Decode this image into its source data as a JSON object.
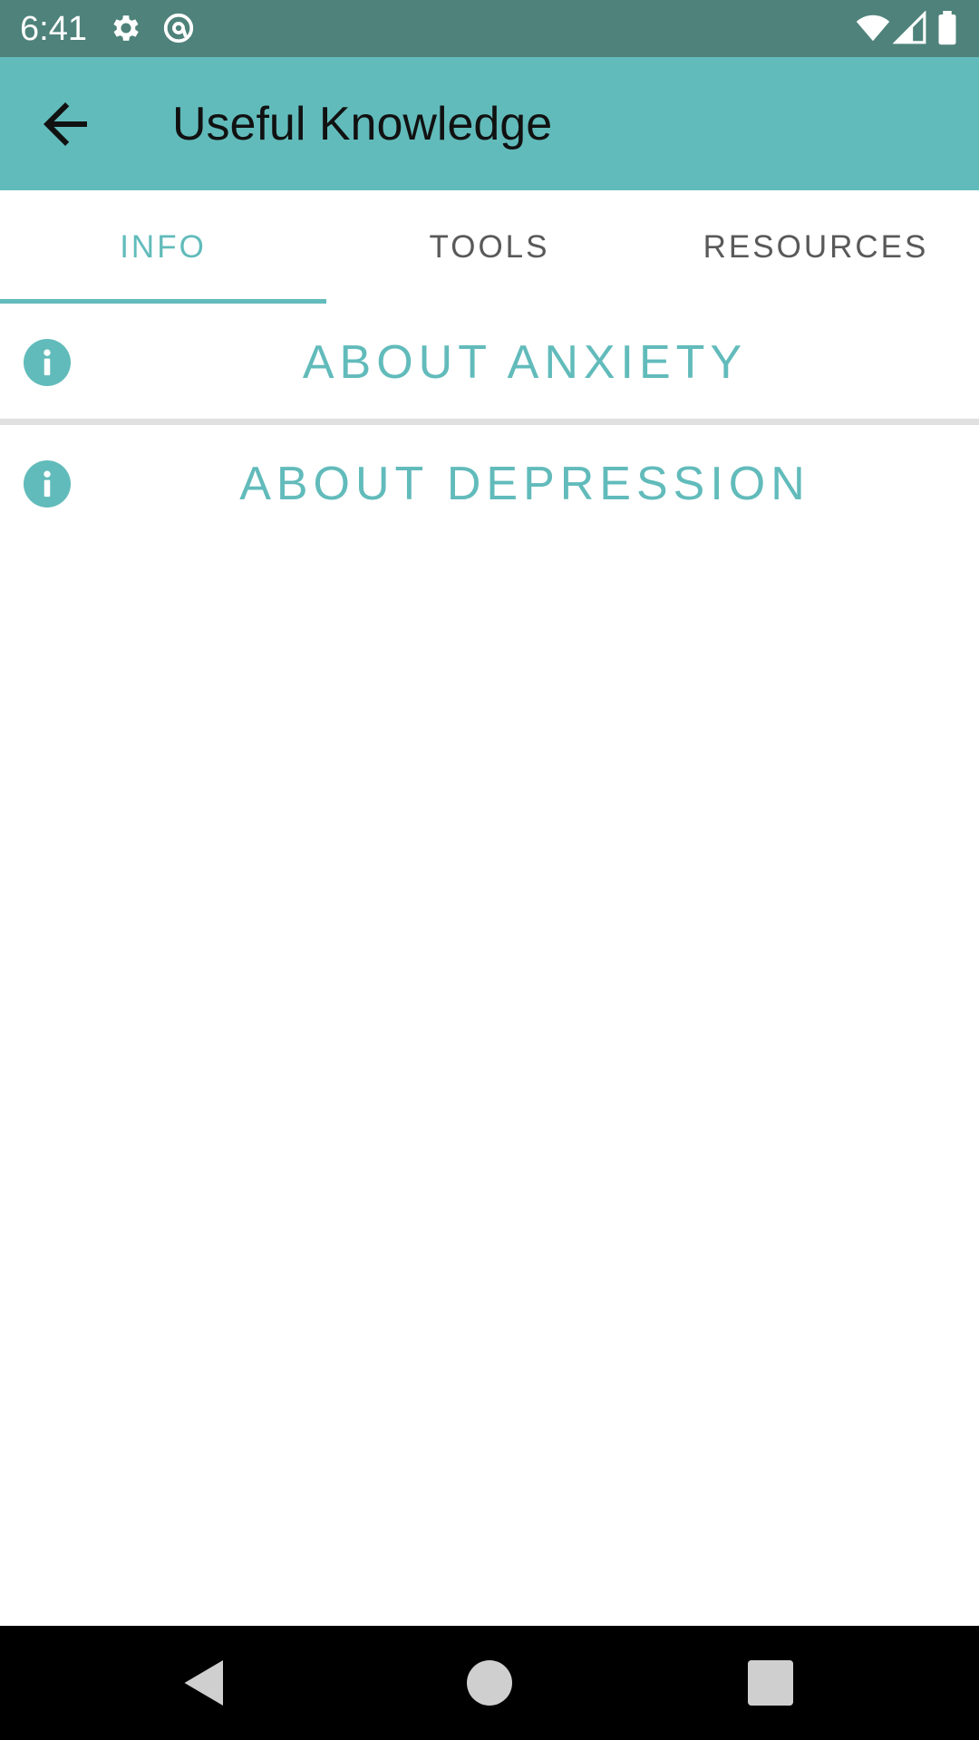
{
  "status_bar": {
    "time": "6:41",
    "icons": [
      "settings-gear-icon",
      "at-sign-icon",
      "wifi-icon",
      "signal-icon",
      "battery-icon"
    ]
  },
  "app_bar": {
    "title": "Useful Knowledge",
    "back_icon": "arrow-back-icon"
  },
  "tabs": [
    {
      "label": "INFO",
      "active": true
    },
    {
      "label": "TOOLS",
      "active": false
    },
    {
      "label": "RESOURCES",
      "active": false
    }
  ],
  "list": {
    "items": [
      {
        "label": "ABOUT ANXIETY",
        "icon": "info-icon"
      },
      {
        "label": "ABOUT DEPRESSION",
        "icon": "info-icon"
      }
    ]
  },
  "nav_bar": {
    "buttons": [
      "back-triangle-icon",
      "home-circle-icon",
      "recents-square-icon"
    ]
  },
  "colors": {
    "status_bar": "#4e827a",
    "app_bar": "#62bbbb",
    "accent": "#62bbbb",
    "tab_inactive": "#595959",
    "divider": "#e0e0e0",
    "nav_bar": "#000000"
  }
}
